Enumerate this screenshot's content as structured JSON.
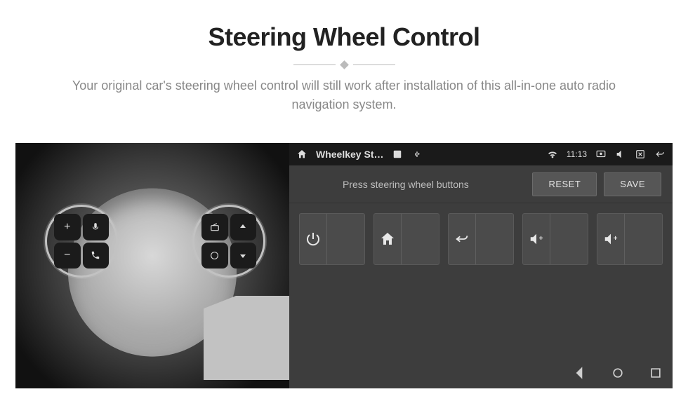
{
  "header": {
    "title": "Steering Wheel Control",
    "subtitle": "Your original car's steering wheel control will still work after installation of this all-in-one auto radio navigation system."
  },
  "wheel": {
    "left_cluster": [
      "+",
      "voice",
      "−",
      "phone"
    ],
    "right_cluster": [
      "radio",
      "up",
      "source",
      "down"
    ]
  },
  "device": {
    "statusbar": {
      "app_title": "Wheelkey St…",
      "time": "11:13",
      "icons": [
        "home",
        "usb",
        "wifi",
        "cast",
        "mute",
        "close",
        "back"
      ]
    },
    "toolbar": {
      "instruction": "Press steering wheel buttons",
      "reset_label": "RESET",
      "save_label": "SAVE"
    },
    "cards": [
      {
        "name": "power",
        "icon": "power"
      },
      {
        "name": "home",
        "icon": "home"
      },
      {
        "name": "back",
        "icon": "back"
      },
      {
        "name": "vol-up-1",
        "icon": "volup"
      },
      {
        "name": "vol-up-2",
        "icon": "volup"
      }
    ],
    "sysnav": [
      "back",
      "home",
      "recent"
    ]
  }
}
